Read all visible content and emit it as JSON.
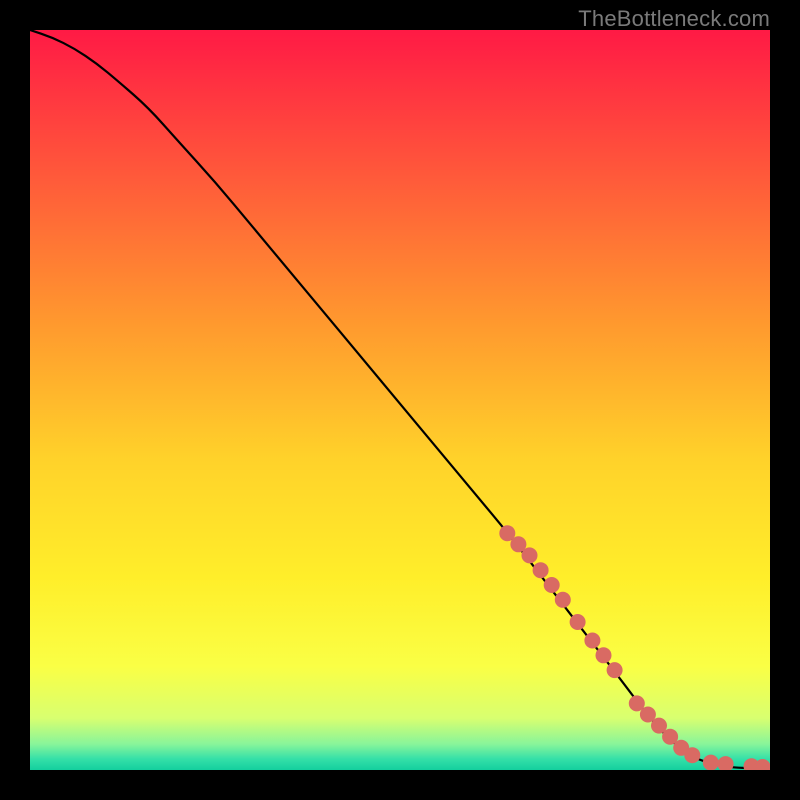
{
  "watermark": "TheBottleneck.com",
  "chart_data": {
    "type": "line",
    "title": "",
    "xlabel": "",
    "ylabel": "",
    "xlim": [
      0,
      100
    ],
    "ylim": [
      0,
      100
    ],
    "grid": false,
    "legend": false,
    "gradient_stops": [
      {
        "pos": 0.0,
        "color": "#ff1a45"
      },
      {
        "pos": 0.2,
        "color": "#ff5a3a"
      },
      {
        "pos": 0.4,
        "color": "#ff9a2e"
      },
      {
        "pos": 0.58,
        "color": "#ffd22a"
      },
      {
        "pos": 0.74,
        "color": "#ffee2a"
      },
      {
        "pos": 0.86,
        "color": "#faff45"
      },
      {
        "pos": 0.93,
        "color": "#d8ff70"
      },
      {
        "pos": 0.965,
        "color": "#88f59a"
      },
      {
        "pos": 0.985,
        "color": "#35e0a8"
      },
      {
        "pos": 1.0,
        "color": "#13cf9e"
      }
    ],
    "curve": {
      "name": "bottleneck-curve",
      "x": [
        0,
        3,
        6,
        9,
        12,
        16,
        20,
        25,
        30,
        35,
        40,
        45,
        50,
        55,
        60,
        65,
        70,
        75,
        80,
        83,
        86,
        89,
        92,
        95,
        100
      ],
      "y": [
        100,
        99,
        97.5,
        95.5,
        93,
        89.5,
        85,
        79.5,
        73.5,
        67.5,
        61.5,
        55.5,
        49.5,
        43.5,
        37.5,
        31.5,
        25,
        18.5,
        12,
        8,
        4.5,
        2,
        0.8,
        0.3,
        0.2
      ]
    },
    "markers": {
      "name": "highlight-points",
      "color": "#d96a63",
      "radius_px": 8,
      "x": [
        64.5,
        66,
        67.5,
        69,
        70.5,
        72,
        74,
        76,
        77.5,
        79,
        82,
        83.5,
        85,
        86.5,
        88,
        89.5,
        92,
        94,
        97.5,
        99
      ],
      "y": [
        32,
        30.5,
        29,
        27,
        25,
        23,
        20,
        17.5,
        15.5,
        13.5,
        9,
        7.5,
        6,
        4.5,
        3,
        2,
        1,
        0.8,
        0.5,
        0.4
      ]
    }
  }
}
